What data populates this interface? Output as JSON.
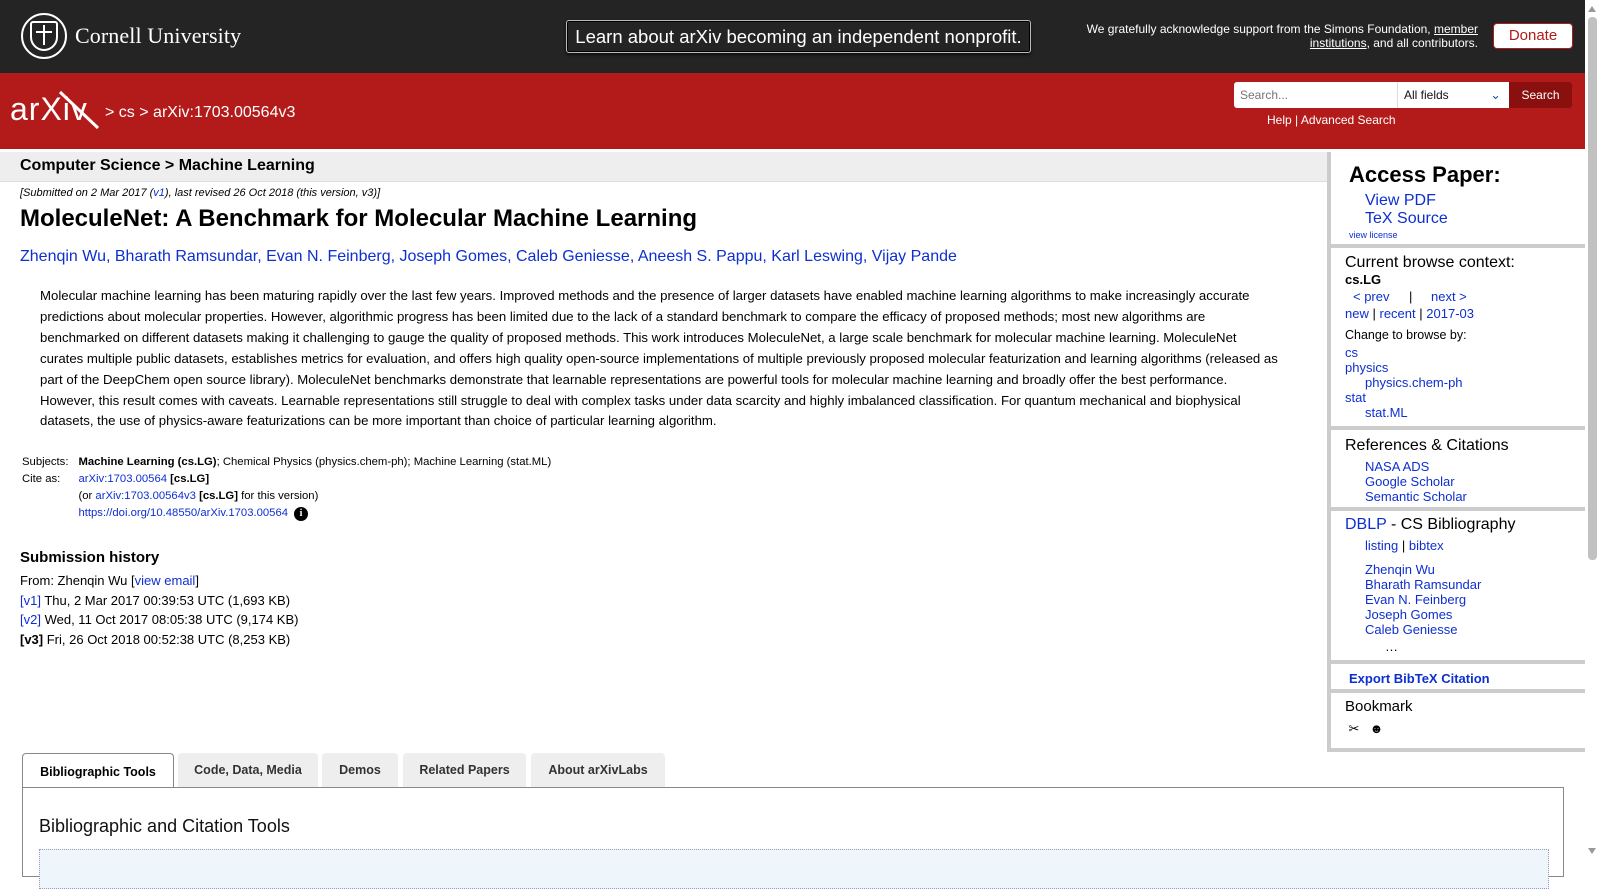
{
  "topbar": {
    "cornell_name": "Cornell University",
    "announcement": "Learn about arXiv becoming an independent nonprofit.",
    "support_pre": "We gratefully acknowledge support from the Simons Foundation,",
    "support_link1": "member",
    "support_link2": "institutions",
    "support_post": ", and all contributors.",
    "donate": "Donate"
  },
  "header": {
    "logo_text": "arXiv",
    "crumb_sep": ">",
    "crumb_cs": "cs",
    "crumb_id": "arXiv:1703.00564v3",
    "search_placeholder": "Search...",
    "field_select": "All fields",
    "search_button": "Search",
    "help": "Help",
    "link_sep": "|",
    "advanced": "Advanced Search"
  },
  "subject_bar": "Computer Science > Machine Learning",
  "dateline": {
    "pre": "[Submitted on 2 Mar 2017 (",
    "v1": "v1",
    "post": "), last revised 26 Oct 2018 (this version, v3)]"
  },
  "title": "MoleculeNet: A Benchmark for Molecular Machine Learning",
  "authors": [
    "Zhenqin Wu",
    "Bharath Ramsundar",
    "Evan N. Feinberg",
    "Joseph Gomes",
    "Caleb Geniesse",
    "Aneesh S. Pappu",
    "Karl Leswing",
    "Vijay Pande"
  ],
  "abstract": "Molecular machine learning has been maturing rapidly over the last few years. Improved methods and the presence of larger datasets have enabled machine learning algorithms to make increasingly accurate predictions about molecular properties. However, algorithmic progress has been limited due to the lack of a standard benchmark to compare the efficacy of proposed methods; most new algorithms are benchmarked on different datasets making it challenging to gauge the quality of proposed methods. This work introduces MoleculeNet, a large scale benchmark for molecular machine learning. MoleculeNet curates multiple public datasets, establishes metrics for evaluation, and offers high quality open-source implementations of multiple previously proposed molecular featurization and learning algorithms (released as part of the DeepChem open source library). MoleculeNet benchmarks demonstrate that learnable representations are powerful tools for molecular machine learning and broadly offer the best performance. However, this result comes with caveats. Learnable representations still struggle to deal with complex tasks under data scarcity and highly imbalanced classification. For quantum mechanical and biophysical datasets, the use of physics-aware featurizations can be more important than choice of particular learning algorithm.",
  "meta": {
    "subjects_label": "Subjects:",
    "subject_primary": "Machine Learning (cs.LG)",
    "subject_rest": "; Chemical Physics (physics.chem-ph); Machine Learning (stat.ML)",
    "cite_label": "Cite as:",
    "cite_id": "arXiv:1703.00564",
    "cite_tag": "[cs.LG]",
    "cite2_pre": "(or ",
    "cite2_id": "arXiv:1703.00564v3",
    "cite2_tag": "[cs.LG]",
    "cite2_post": " for this version)",
    "doi": "https://doi.org/10.48550/arXiv.1703.00564",
    "info_icon": "i"
  },
  "submission": {
    "heading": "Submission history",
    "from_pre": "From: Zhenqin Wu [",
    "view_email": "view email",
    "from_post": "]",
    "versions": [
      {
        "label": "[v1]",
        "text": " Thu, 2 Mar 2017 00:39:53 UTC (1,693 KB)"
      },
      {
        "label": "[v2]",
        "text": " Wed, 11 Oct 2017 08:05:38 UTC (9,174 KB)"
      },
      {
        "label": "[v3]",
        "text": " Fri, 26 Oct 2018 00:52:38 UTC (8,253 KB)"
      }
    ]
  },
  "tabs": [
    "Bibliographic Tools",
    "Code, Data, Media",
    "Demos",
    "Related Papers",
    "About arXivLabs"
  ],
  "panel_title": "Bibliographic and Citation Tools",
  "sidebar": {
    "access_heading": "Access Paper:",
    "view_pdf": "View PDF",
    "tex_source": "TeX Source",
    "view_license": "view license",
    "browse_heading": "Current browse context:",
    "browse_context": "cs.LG",
    "prev": "< prev",
    "pipe": "|",
    "next": "next >",
    "new": "new",
    "recent": "recent",
    "month": "2017-03",
    "change_to": "Change to browse by:",
    "browse": [
      "cs",
      "physics",
      "physics.chem-ph",
      "stat",
      "stat.ML"
    ],
    "refs_heading": "References & Citations",
    "refs": [
      "NASA ADS",
      "Google Scholar",
      "Semantic Scholar"
    ],
    "dblp": "DBLP",
    "dblp_post": " - CS Bibliography",
    "listing": "listing",
    "bibtex": "bibtex",
    "dblp_authors": [
      "Zhenqin Wu",
      "Bharath Ramsundar",
      "Evan N. Feinberg",
      "Joseph Gomes",
      "Caleb Geniesse"
    ],
    "ellipsis": "…",
    "export": "Export BibTeX Citation",
    "bookmark": "Bookmark",
    "bookmark_icons": [
      "✂",
      "☻"
    ]
  }
}
